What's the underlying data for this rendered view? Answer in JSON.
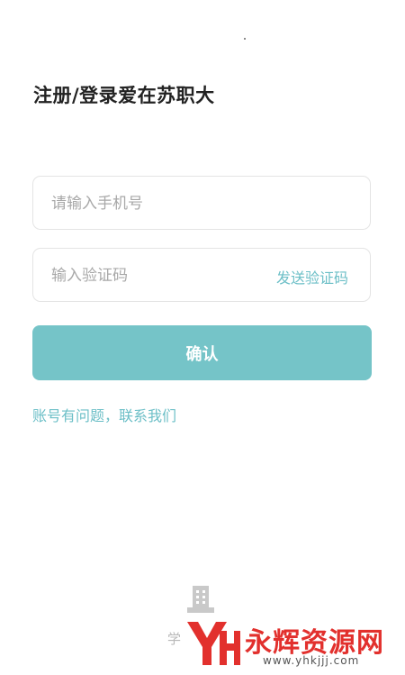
{
  "header": {
    "title": "注册/登录爱在苏职大"
  },
  "form": {
    "phone_placeholder": "请输入手机号",
    "code_placeholder": "输入验证码",
    "send_code_label": "发送验证码",
    "confirm_label": "确认",
    "help_link": "账号有问题，联系我们"
  },
  "footer": {
    "icon": "building-icon",
    "text": "学"
  },
  "watermark": {
    "name": "永辉资源网",
    "url": "www.yhkjjj.com",
    "logo": "yh-logo"
  },
  "colors": {
    "accent": "#75c4c8",
    "link": "#6cbfc7",
    "title": "#222222",
    "watermark_red": "#e2302d"
  }
}
